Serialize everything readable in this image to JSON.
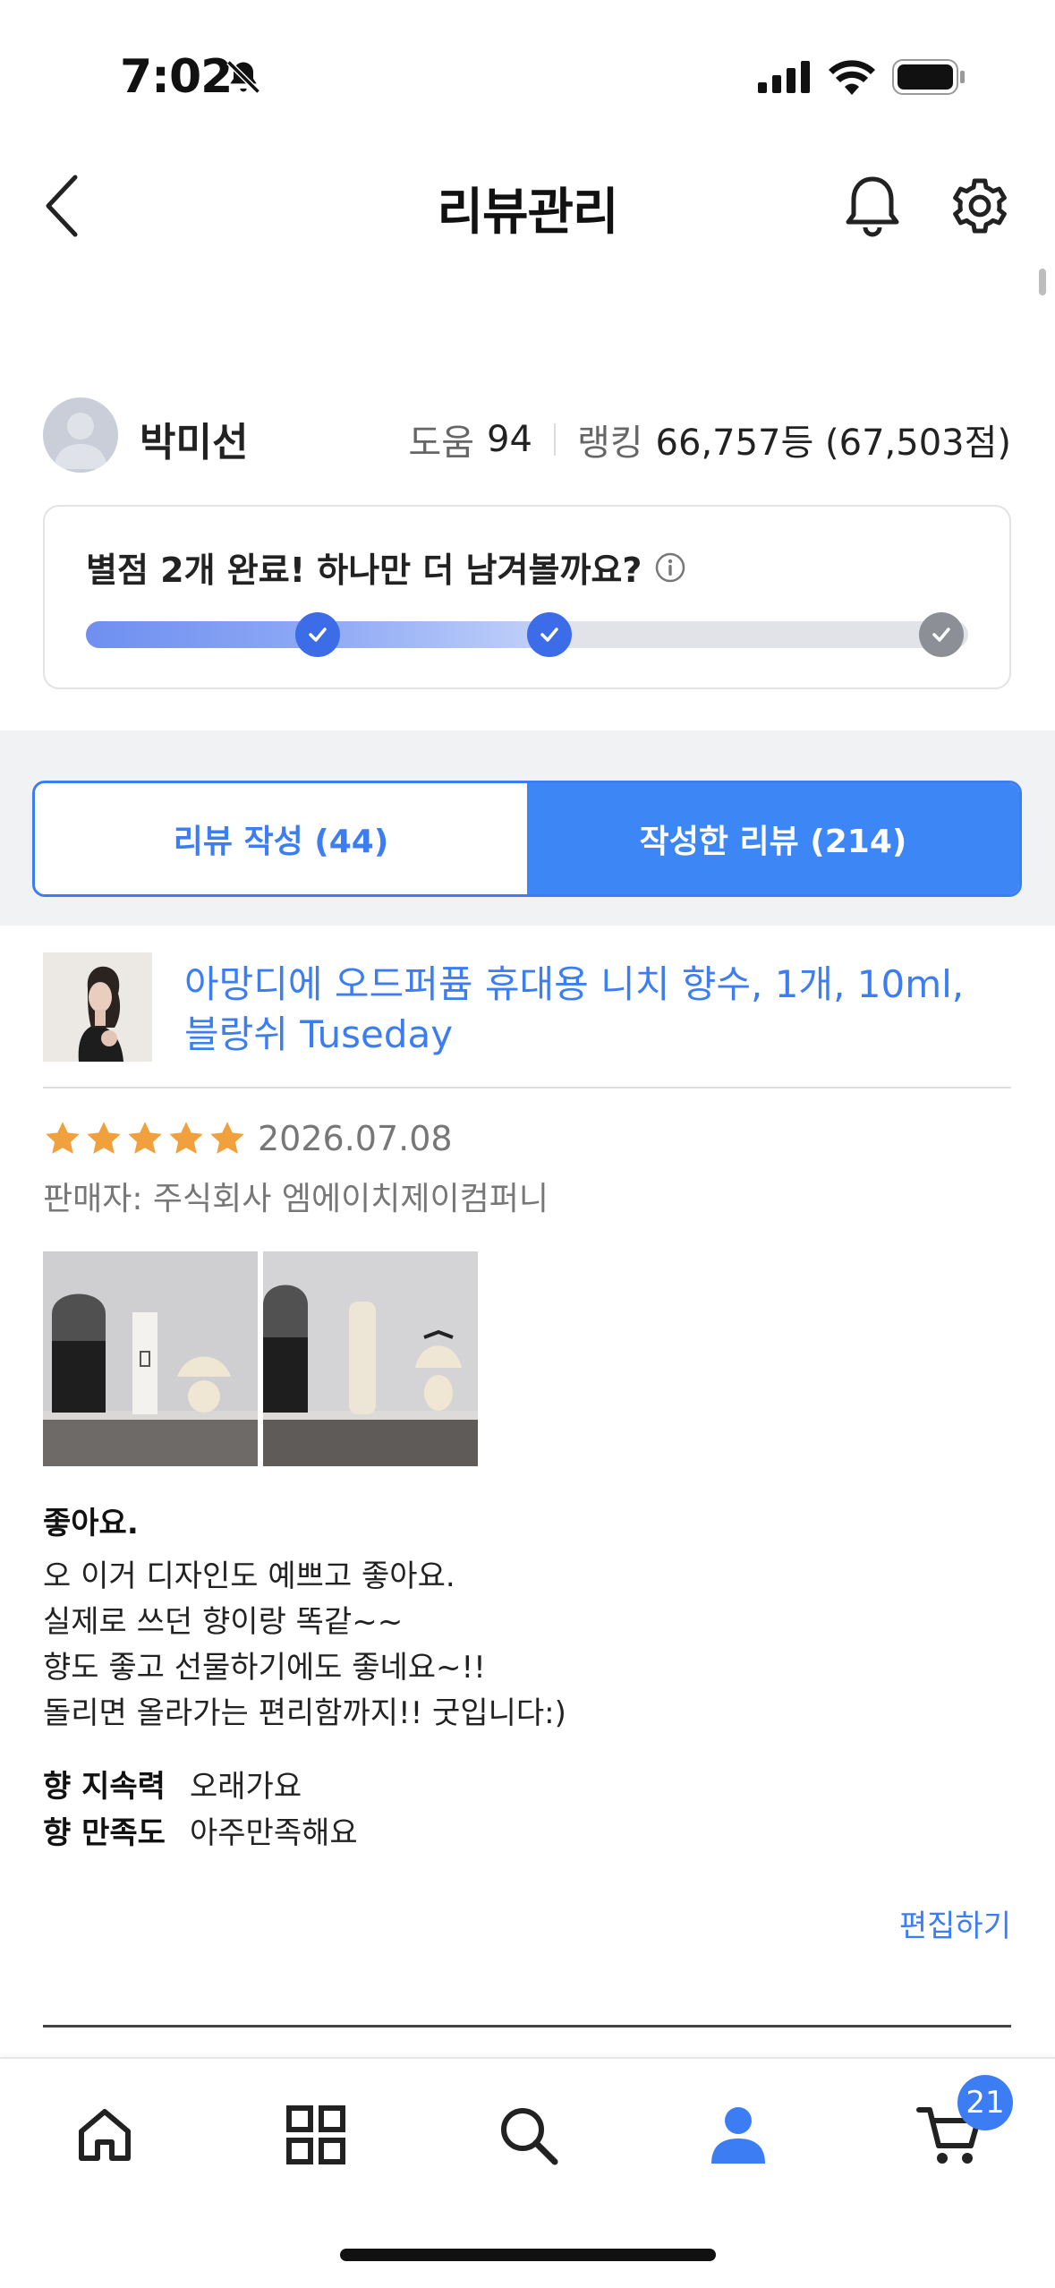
{
  "status_bar": {
    "time": "7:02",
    "icons": [
      "bell-slash-icon",
      "signal-icon",
      "wifi-icon",
      "battery-icon"
    ]
  },
  "header": {
    "title": "리뷰관리",
    "icons": [
      "back-icon",
      "bell-icon",
      "gear-icon"
    ]
  },
  "profile": {
    "name": "박미선",
    "help_label": "도움",
    "help_value": "94",
    "rank_label": "랭킹",
    "rank_value": "66,757등 (67,503점)"
  },
  "progress": {
    "title": "별점 2개 완료! 하나만 더 남겨볼까요?",
    "completed": 2,
    "total": 3
  },
  "tabs": [
    {
      "label": "리뷰 작성 (44)",
      "active": false
    },
    {
      "label": "작성한 리뷰 (214)",
      "active": true
    }
  ],
  "review": {
    "product_name": "아망디에 오드퍼퓸 휴대용 니치 향수, 1개, 10ml, 블랑쉬 Tuseday",
    "rating": 5,
    "date": "2026.07.08",
    "seller": "판매자: 주식회사 엠에이치제이컴퍼니",
    "title": "좋아요.",
    "body_lines": [
      "오 이거 디자인도 예쁘고 좋아요.",
      "실제로 쓰던 향이랑 똑같~~",
      "향도 좋고 선물하기에도 좋네요~!!",
      "돌리면 올라가는 편리함까지!! 굿입니다:)"
    ],
    "attributes": [
      {
        "label": "향 지속력",
        "value": "오래가요"
      },
      {
        "label": "향 만족도",
        "value": "아주만족해요"
      }
    ],
    "edit_label": "편집하기"
  },
  "tabbar": {
    "items": [
      "home-icon",
      "grid-icon",
      "search-icon",
      "profile-icon",
      "cart-icon"
    ],
    "active": "profile-icon",
    "cart_count": "21"
  },
  "colors": {
    "accent": "#3d7df4",
    "star": "#f0a03c",
    "milestone_done": "#3d6ce8",
    "milestone_todo": "#8c8f96"
  }
}
